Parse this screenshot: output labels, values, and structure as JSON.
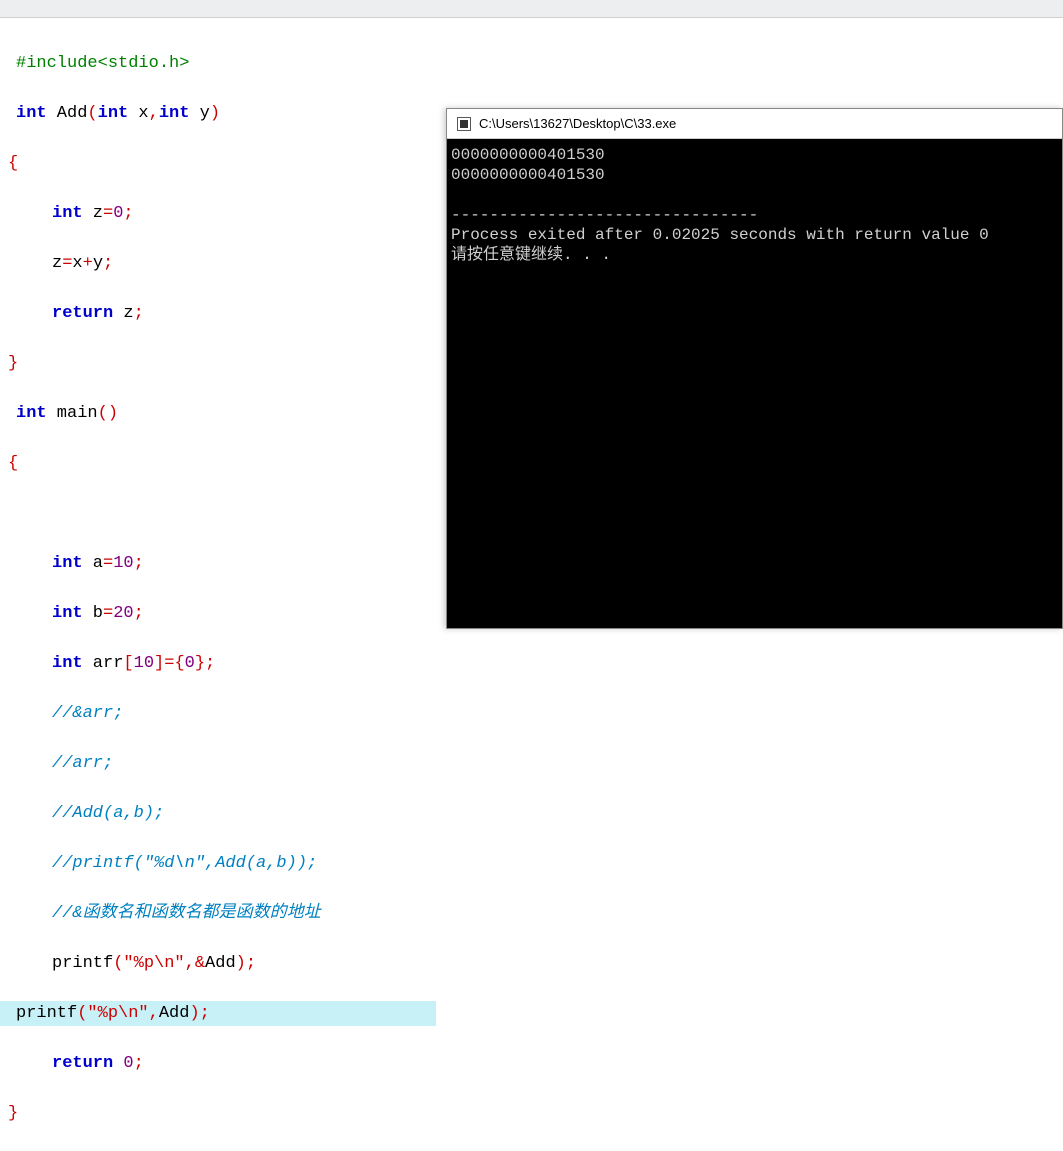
{
  "code": {
    "l1_include": "#include",
    "l1_header": "<stdio.h>",
    "l2_int": "int",
    "l2_add": " Add",
    "l2_paren_open": "(",
    "l2_intx": "int",
    "l2_x": " x",
    "l2_comma": ",",
    "l2_inty": "int",
    "l2_y": " y",
    "l2_paren_close": ")",
    "l3_brace": "{",
    "l4_int": "int",
    "l4_z": " z",
    "l4_eq": "=",
    "l4_zero": "0",
    "l4_semi": ";",
    "l5_z": "z",
    "l5_eq": "=",
    "l5_x": "x",
    "l5_plus": "+",
    "l5_y": "y",
    "l5_semi": ";",
    "l6_return": "return",
    "l6_z": " z",
    "l6_semi": ";",
    "l7_brace": "}",
    "l8_int": "int",
    "l8_main": " main",
    "l8_parens": "()",
    "l9_brace": "{",
    "l11_int": "int",
    "l11_a": " a",
    "l11_eq": "=",
    "l11_10": "10",
    "l11_semi": ";",
    "l12_int": "int",
    "l12_b": " b",
    "l12_eq": "=",
    "l12_20": "20",
    "l12_semi": ";",
    "l13_int": "int",
    "l13_arr": " arr",
    "l13_br1": "[",
    "l13_10": "10",
    "l13_br2": "]=",
    "l13_bo": "{",
    "l13_0": "0",
    "l13_bc": "}",
    "l13_semi": ";",
    "l14_c": "//&arr;",
    "l15_c": "//arr;",
    "l16_c": "//Add(a,b);",
    "l17_c": "//printf(\"%d\\n\",Add(a,b));",
    "l18_c": "//&函数名和函数名都是函数的地址",
    "l19_printf": "printf",
    "l19_po": "(",
    "l19_str": "\"%p\\n\"",
    "l19_comma": ",&",
    "l19_add": "Add",
    "l19_pc": ")",
    "l19_semi": ";",
    "l20_printf": "printf",
    "l20_po": "(",
    "l20_str": "\"%p\\n\"",
    "l20_comma": ",",
    "l20_add": "Add",
    "l20_pc": ")",
    "l20_semi": ";",
    "l21_return": "return",
    "l21_sp": " ",
    "l21_0": "0",
    "l21_semi": ";",
    "l22_brace": "}"
  },
  "console": {
    "title": "C:\\Users\\13627\\Desktop\\C\\33.exe",
    "line1": "0000000000401530",
    "line2": "0000000000401530",
    "blank": "",
    "sep": "--------------------------------",
    "exit": "Process exited after 0.02025 seconds with return value 0",
    "prompt": "请按任意键继续. . ."
  }
}
